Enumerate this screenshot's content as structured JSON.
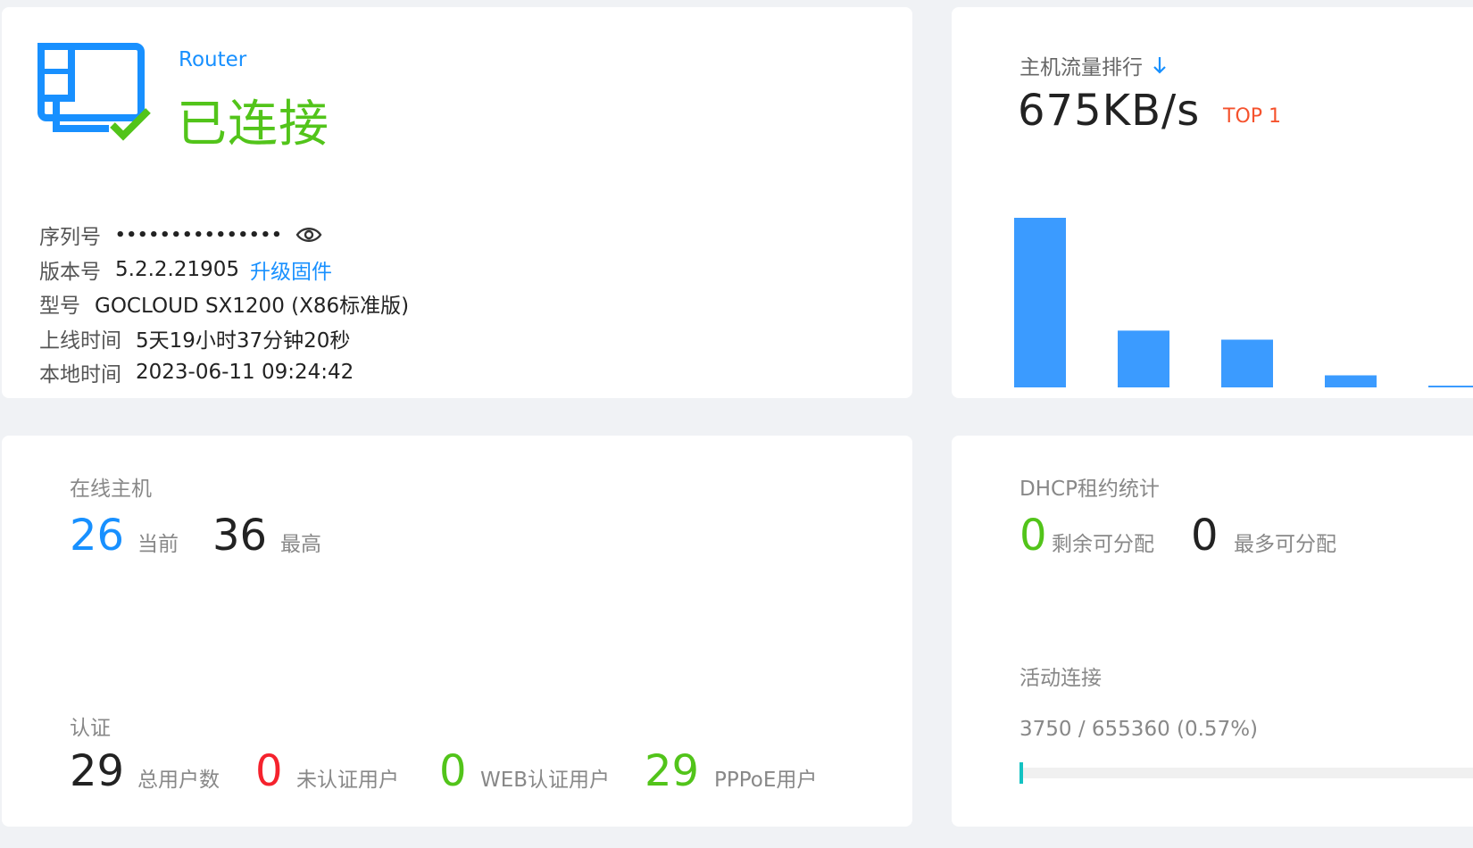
{
  "router": {
    "name": "Router",
    "status": "已连接",
    "status_color": "#52c41a",
    "icon": "router-connected-icon",
    "info": {
      "serial_label": "序列号",
      "serial_value": "•••••••••••••••",
      "version_label": "版本号",
      "version_value": "5.2.2.21905",
      "upgrade_link": "升级固件",
      "model_label": "型号",
      "model_value": "GOCLOUD SX1200 (X86标准版)",
      "uptime_label": "上线时间",
      "uptime_value": "5天19小时37分钟20秒",
      "localtime_label": "本地时间",
      "localtime_value": "2023-06-11 09:24:42"
    }
  },
  "traffic": {
    "title": "主机流量排行",
    "sort_icon": "arrow-down-icon",
    "value": "675KB/s",
    "rank": "TOP 1",
    "accent": "#1890ff"
  },
  "chart_data": {
    "type": "bar",
    "categories": [
      "",
      "",
      "",
      "",
      ""
    ],
    "values": [
      675,
      226,
      190,
      48,
      3
    ],
    "title": "",
    "xlabel": "",
    "ylabel": "",
    "ylim": [
      0,
      675
    ],
    "grid": false,
    "color": "#3b9bff"
  },
  "hosts": {
    "title": "在线主机",
    "current_value": "26",
    "current_label": "当前",
    "max_value": "36",
    "max_label": "最高"
  },
  "auth": {
    "title": "认证",
    "total_value": "29",
    "total_label": "总用户数",
    "unauth_value": "0",
    "unauth_label": "未认证用户",
    "web_value": "0",
    "web_label": "WEB认证用户",
    "pppoe_value": "29",
    "pppoe_label": "PPPoE用户"
  },
  "dhcp": {
    "title": "DHCP租约统计",
    "remaining_value": "0",
    "remaining_label": "剩余可分配",
    "max_value": "0",
    "max_label": "最多可分配"
  },
  "connections": {
    "title": "活动连接",
    "usage_text": "3750 / 655360 (0.57%)",
    "fraction": 0.0057,
    "color": "#13c2c2"
  }
}
